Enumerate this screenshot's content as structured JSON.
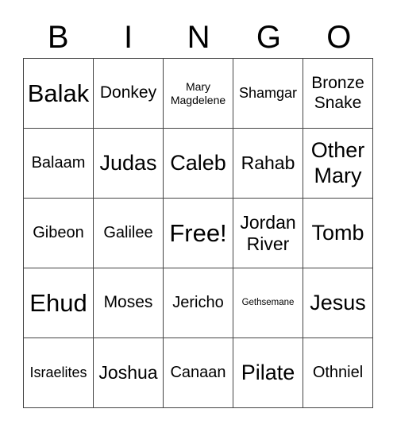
{
  "header": [
    "B",
    "I",
    "N",
    "G",
    "O"
  ],
  "cells": [
    [
      "Balak",
      "Donkey",
      "Mary Magdelene",
      "Shamgar",
      "Bronze Snake"
    ],
    [
      "Balaam",
      "Judas",
      "Caleb",
      "Rahab",
      "Other Mary"
    ],
    [
      "Gibeon",
      "Galilee",
      "Free!",
      "Jordan River",
      "Tomb"
    ],
    [
      "Ehud",
      "Moses",
      "Jericho",
      "Gethsemane",
      "Jesus"
    ],
    [
      "Israelites",
      "Joshua",
      "Canaan",
      "Pilate",
      "Othniel"
    ]
  ]
}
